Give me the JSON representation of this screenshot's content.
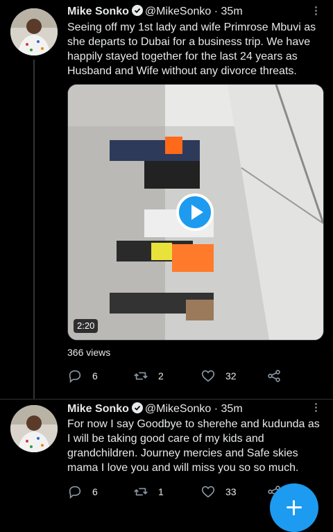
{
  "colors": {
    "accent": "#1d9bf0",
    "background": "#000000",
    "text": "#e7e9ea",
    "muted": "#71767b"
  },
  "tweets": [
    {
      "name": "Mike Sonko",
      "handle": "@MikeSonko",
      "separator": "·",
      "time": "35m",
      "text": "Seeing off my 1st lady and wife Primrose Mbuvi as she departs to Dubai for a business trip. We have happily stayed together for the last 24 years as Husband and Wife without any divorce threats.",
      "video_duration": "2:20",
      "views": "366 views",
      "replies": "6",
      "retweets": "2",
      "likes": "32"
    },
    {
      "name": "Mike Sonko",
      "handle": "@MikeSonko",
      "separator": "·",
      "time": "35m",
      "text": "For now I say Goodbye to sherehe and kudunda as I will be taking good care of my kids and grandchildren. Journey mercies and Safe skies mama I love you and will miss you so so much.",
      "replies": "6",
      "retweets": "1",
      "likes": "33"
    }
  ],
  "icons": [
    "verified-icon",
    "more-icon",
    "play-icon",
    "reply-icon",
    "retweet-icon",
    "like-icon",
    "share-icon",
    "compose-icon"
  ]
}
